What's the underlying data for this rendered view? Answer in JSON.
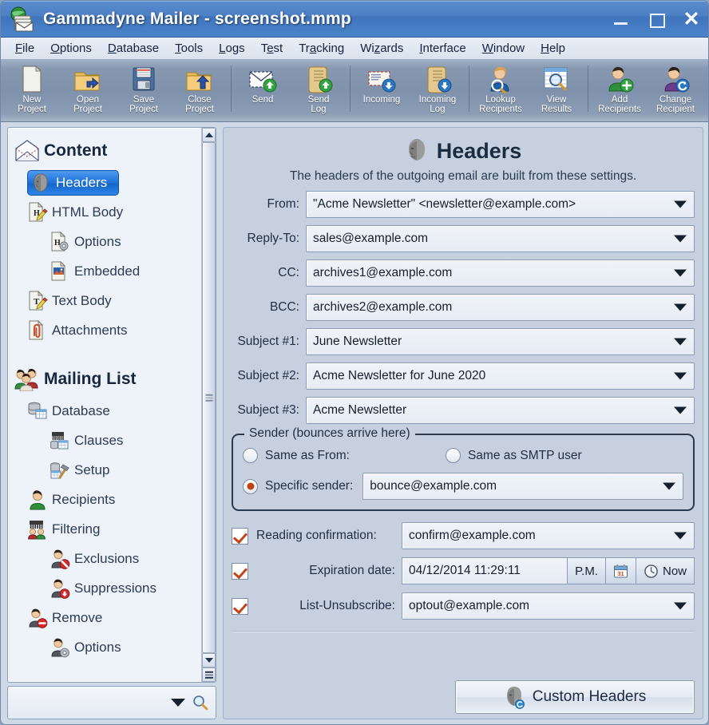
{
  "window": {
    "title": "Gammadyne Mailer - screenshot.mmp",
    "app_icon": "mailer-globe-icon",
    "minimize_label": "Minimize",
    "maximize_label": "Maximize",
    "close_label": "Close"
  },
  "menu": [
    {
      "label": "File",
      "accel": "F"
    },
    {
      "label": "Options",
      "accel": "O"
    },
    {
      "label": "Database",
      "accel": "D"
    },
    {
      "label": "Tools",
      "accel": "T"
    },
    {
      "label": "Logs",
      "accel": "L"
    },
    {
      "label": "Test",
      "accel": "e"
    },
    {
      "label": "Tracking",
      "accel": "a"
    },
    {
      "label": "Wizards",
      "accel": "z"
    },
    {
      "label": "Interface",
      "accel": "I"
    },
    {
      "label": "Window",
      "accel": "W"
    },
    {
      "label": "Help",
      "accel": "H"
    }
  ],
  "toolbar": [
    {
      "id": "new-project",
      "line1": "New",
      "line2": "Project",
      "icon": "new-document-icon"
    },
    {
      "id": "open-project",
      "line1": "Open",
      "line2": "Project",
      "icon": "open-folder-icon"
    },
    {
      "id": "save-project",
      "line1": "Save",
      "line2": "Project",
      "icon": "floppy-disk-icon"
    },
    {
      "id": "close-project",
      "line1": "Close",
      "line2": "Project",
      "icon": "close-folder-icon"
    },
    {
      "id": "sep1",
      "line1": "",
      "line2": "",
      "icon": "separator"
    },
    {
      "id": "send",
      "line1": "Send",
      "line2": "",
      "icon": "envelope-up-icon"
    },
    {
      "id": "send-log",
      "line1": "Send",
      "line2": "Log",
      "icon": "scroll-up-icon"
    },
    {
      "id": "sep2",
      "line1": "",
      "line2": "",
      "icon": "separator"
    },
    {
      "id": "incoming",
      "line1": "Incoming",
      "line2": "",
      "icon": "envelope-down-icon"
    },
    {
      "id": "incoming-log",
      "line1": "Incoming",
      "line2": "Log",
      "icon": "scroll-down-icon"
    },
    {
      "id": "sep3",
      "line1": "",
      "line2": "",
      "icon": "separator"
    },
    {
      "id": "lookup-recipients",
      "line1": "Lookup",
      "line2": "Recipients",
      "icon": "person-search-icon"
    },
    {
      "id": "view-results",
      "line1": "View",
      "line2": "Results",
      "icon": "grid-search-icon"
    },
    {
      "id": "sep4",
      "line1": "",
      "line2": "",
      "icon": "separator"
    },
    {
      "id": "add-recipients",
      "line1": "Add",
      "line2": "Recipients",
      "icon": "person-add-icon"
    },
    {
      "id": "change-recipient",
      "line1": "Change",
      "line2": "Recipient",
      "icon": "person-refresh-icon"
    }
  ],
  "sidebar": {
    "items": [
      {
        "label": "Content",
        "level": 0,
        "icon": "open-envelope-icon",
        "selected": false,
        "root": true
      },
      {
        "label": "Headers",
        "level": 1,
        "icon": "head-icon",
        "selected": true,
        "root": false
      },
      {
        "label": "HTML Body",
        "level": 1,
        "icon": "html-page-edit-icon",
        "selected": false,
        "root": false
      },
      {
        "label": "Options",
        "level": 2,
        "icon": "html-page-gear-icon",
        "selected": false,
        "root": false
      },
      {
        "label": "Embedded",
        "level": 2,
        "icon": "image-page-icon",
        "selected": false,
        "root": false
      },
      {
        "label": "Text Body",
        "level": 1,
        "icon": "text-page-edit-icon",
        "selected": false,
        "root": false
      },
      {
        "label": "Attachments",
        "level": 1,
        "icon": "paperclip-page-icon",
        "selected": false,
        "root": false
      },
      {
        "label": "Mailing List",
        "level": 0,
        "icon": "people-group-icon",
        "selected": false,
        "root": true
      },
      {
        "label": "Database",
        "level": 1,
        "icon": "database-table-icon",
        "selected": false,
        "root": false
      },
      {
        "label": "Clauses",
        "level": 2,
        "icon": "comb-database-icon",
        "selected": false,
        "root": false
      },
      {
        "label": "Setup",
        "level": 2,
        "icon": "table-hammer-icon",
        "selected": false,
        "root": false
      },
      {
        "label": "Recipients",
        "level": 1,
        "icon": "person-green-icon",
        "selected": false,
        "root": false
      },
      {
        "label": "Filtering",
        "level": 1,
        "icon": "comb-people-icon",
        "selected": false,
        "root": false
      },
      {
        "label": "Exclusions",
        "level": 2,
        "icon": "person-deny-icon",
        "selected": false,
        "root": false
      },
      {
        "label": "Suppressions",
        "level": 2,
        "icon": "person-down-icon",
        "selected": false,
        "root": false
      },
      {
        "label": "Remove",
        "level": 1,
        "icon": "person-minus-icon",
        "selected": false,
        "root": false
      },
      {
        "label": "Options",
        "level": 2,
        "icon": "person-gear-icon",
        "selected": false,
        "root": false
      }
    ],
    "search_placeholder": "",
    "search_value": "",
    "search_icon": "magnifier-icon",
    "dropdown_icon": "chevron-down-icon"
  },
  "panel": {
    "icon": "head-icon",
    "title": "Headers",
    "subtitle": "The headers of the outgoing email are built from these settings.",
    "fields": [
      {
        "label": "From:",
        "value": "\"Acme Newsletter\" <newsletter@example.com>"
      },
      {
        "label": "Reply-To:",
        "value": "sales@example.com"
      },
      {
        "label": "CC:",
        "value": "archives1@example.com"
      },
      {
        "label": "BCC:",
        "value": "archives2@example.com"
      },
      {
        "label": "Subject #1:",
        "value": "June Newsletter"
      },
      {
        "label": "Subject #2:",
        "value": "Acme Newsletter for June 2020"
      },
      {
        "label": "Subject #3:",
        "value": "Acme Newsletter"
      }
    ],
    "sender_group": {
      "title": "Sender (bounces arrive here)",
      "option_same_as_from": "Same as From:",
      "option_same_as_smtp": "Same as SMTP user",
      "option_specific": "Specific sender:",
      "selected": "specific",
      "specific_value": "bounce@example.com",
      "accent": "#c4441a"
    },
    "reading_confirmation": {
      "checked": true,
      "label": "Reading confirmation:",
      "value": "confirm@example.com"
    },
    "expiration": {
      "checked": true,
      "label": "Expiration date:",
      "value": "04/12/2014 11:29:11",
      "meridiem": "P.M.",
      "calendar_icon": "calendar-icon",
      "calendar_day": "31",
      "now_label": "Now",
      "now_icon": "clock-icon"
    },
    "list_unsubscribe": {
      "checked": true,
      "label": "List-Unsubscribe:",
      "value": "optout@example.com"
    },
    "custom_headers_button": {
      "label": "Custom Headers",
      "icon": "head-blue-badge-icon"
    }
  },
  "colors": {
    "titlebar": "#4c7fc4",
    "selection": "#1a6fd6",
    "panel_bg": "#c6d0df",
    "tree_bg": "#eef2f9",
    "accent_red": "#c4441a"
  }
}
